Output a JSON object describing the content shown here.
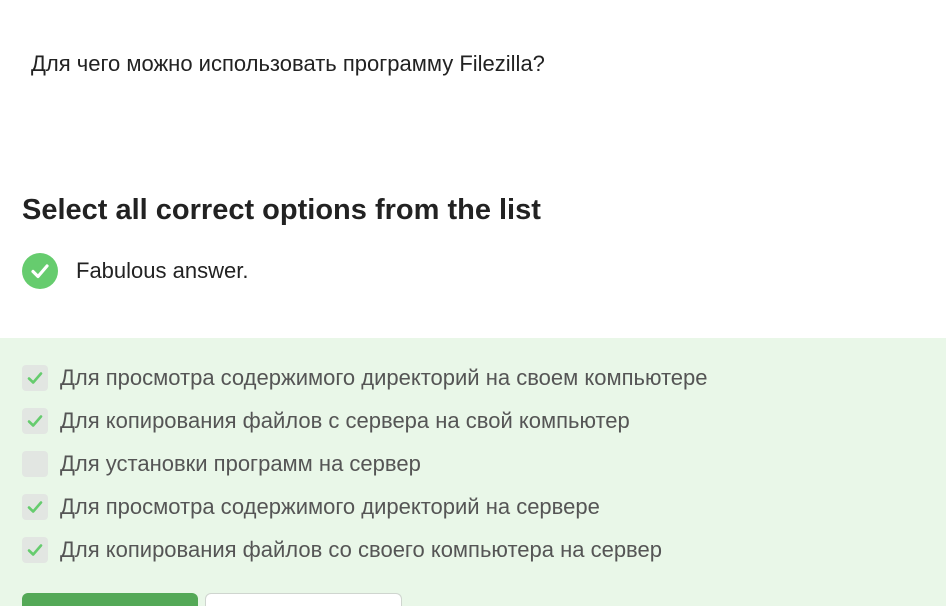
{
  "question": {
    "text": "Для чего можно использовать программу Filezilla?"
  },
  "instruction": "Select all correct options from the list",
  "feedback": {
    "icon": "check-circle-icon",
    "text": "Fabulous answer.",
    "color": "#66cc6e"
  },
  "options": [
    {
      "label": "Для просмотра содержимого директорий на своем компьютере",
      "checked": true
    },
    {
      "label": "Для копирования файлов с сервера на свой компьютер",
      "checked": true
    },
    {
      "label": "Для установки программ на сервер",
      "checked": false
    },
    {
      "label": "Для просмотра содержимого директорий на сервере",
      "checked": true
    },
    {
      "label": "Для копирования файлов со своего компьютера на сервер",
      "checked": true
    }
  ],
  "colors": {
    "accent": "#54a957",
    "panel_background": "#e9f7e8",
    "checkmark": "#66cc6e"
  }
}
